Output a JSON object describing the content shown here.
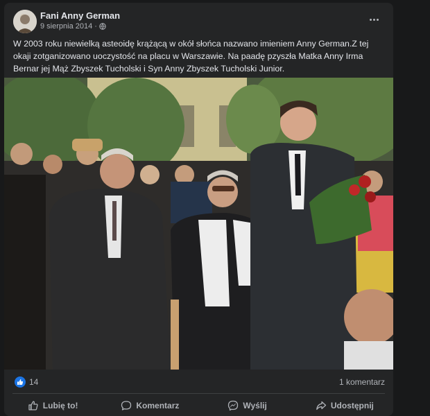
{
  "post": {
    "page_name": "Fani Anny German",
    "date": "9 sierpnia 2014",
    "date_separator": "·",
    "avatar_icon": "page-avatar",
    "text": "W 2003 roku niewielką asteoidę krążącą w okół słońca nazwano imieniem Anny German.Z tej okaji zotganizowano uoczystość na placu w Warszawie. Na paadę pzyszła Matka Anny Irma Bernar jej Mąż Zbyszek Tucholski i Syn Anny Zbyszek Tucholski Junior.",
    "photo_alt": "Photo of ceremony in Warsaw"
  },
  "stats": {
    "reactions_count": "14",
    "comments_count": "1 komentarz"
  },
  "actions": {
    "like": "Lubię to!",
    "comment": "Komentarz",
    "send": "Wyślij",
    "share": "Udostępnij"
  },
  "colors": {
    "background": "#18191a",
    "card": "#242526",
    "accent": "#1b74e4",
    "secondary_text": "#b0b3b8"
  }
}
